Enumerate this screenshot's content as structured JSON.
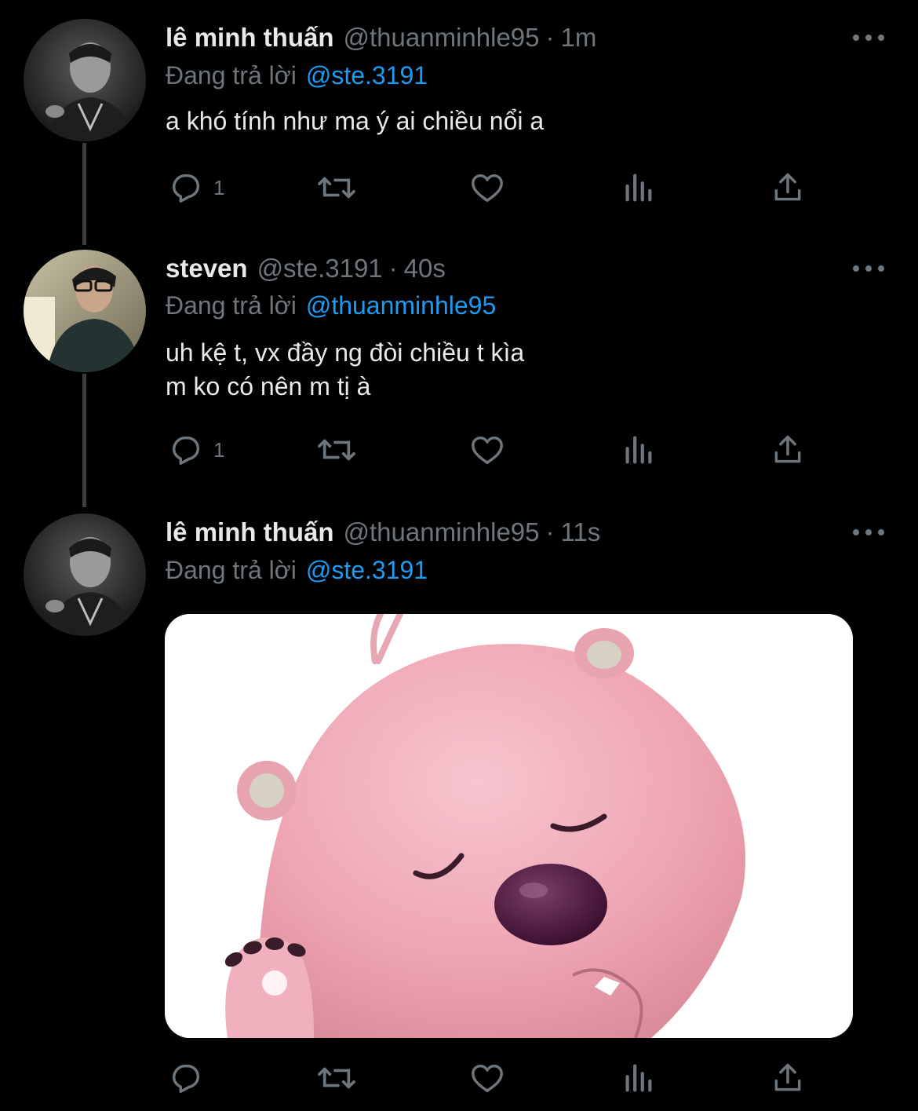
{
  "colors": {
    "background": "#000000",
    "text_primary": "#e7e9ea",
    "text_secondary": "#6e767d",
    "link": "#1d9bf0",
    "thread_line": "#3a3d40"
  },
  "tweets": [
    {
      "display_name": "lê minh thuấn",
      "handle": "@thuanminhle95",
      "separator": "·",
      "time": "1m",
      "reply_prefix": "Đang trả lời",
      "reply_to": "@ste.3191",
      "text": "a khó tính như ma ý ai chiều nổi a",
      "reply_count": "1",
      "avatar": "avatar-thuan",
      "icons": [
        "reply-icon",
        "retweet-icon",
        "like-icon",
        "views-icon",
        "share-icon",
        "more-icon"
      ]
    },
    {
      "display_name": "steven",
      "handle": "@ste.3191",
      "separator": "·",
      "time": "40s",
      "reply_prefix": "Đang trả lời",
      "reply_to": "@thuanminhle95",
      "text": "uh kệ t, vx đầy ng đòi chiều t kìa\nm ko có nên m tị à",
      "reply_count": "1",
      "avatar": "avatar-steven",
      "icons": [
        "reply-icon",
        "retweet-icon",
        "like-icon",
        "views-icon",
        "share-icon",
        "more-icon"
      ]
    },
    {
      "display_name": "lê minh thuấn",
      "handle": "@thuanminhle95",
      "separator": "·",
      "time": "11s",
      "reply_prefix": "Đang trả lời",
      "reply_to": "@ste.3191",
      "media": "pink-beaver-sticker-image",
      "avatar": "avatar-thuan",
      "icons": [
        "reply-icon",
        "retweet-icon",
        "like-icon",
        "views-icon",
        "share-icon",
        "more-icon"
      ]
    }
  ]
}
